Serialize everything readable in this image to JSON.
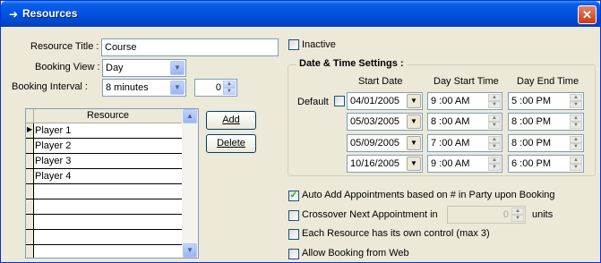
{
  "window": {
    "title": "Resources",
    "close": "✕"
  },
  "form": {
    "resource_title_label": "Resource Title :",
    "resource_title_value": "Course",
    "booking_view_label": "Booking View :",
    "booking_view_value": "Day",
    "booking_interval_label": "Booking Interval :",
    "booking_interval_value": "8 minutes",
    "interval_count": "0",
    "inactive_label": "Inactive"
  },
  "grid": {
    "header": "Resource",
    "rows": [
      "Player 1",
      "Player 2",
      "Player 3",
      "Player 4",
      "",
      "",
      "",
      "",
      ""
    ]
  },
  "buttons": {
    "add": "Add",
    "delete": "Delete"
  },
  "datetime": {
    "title": "Date & Time Settings :",
    "col_start_date": "Start Date",
    "col_day_start": "Day Start Time",
    "col_day_end": "Day End Time",
    "default_label": "Default",
    "rows": [
      {
        "date": "04/01/2005",
        "start": "9 :00 AM",
        "end": "5 :00 PM"
      },
      {
        "date": "05/03/2005",
        "start": "8 :00 AM",
        "end": "8 :00 PM"
      },
      {
        "date": "05/09/2005",
        "start": "7 :00 AM",
        "end": "8 :00 PM"
      },
      {
        "date": "10/16/2005",
        "start": "9 :00 AM",
        "end": "6 :00 PM"
      }
    ]
  },
  "options": {
    "auto_add": "Auto Add Appointments based on # in Party upon Booking",
    "auto_add_checked": true,
    "crossover": "Crossover Next Appointment in",
    "crossover_value": "0",
    "units": "units",
    "each_resource": "Each Resource has its own control (max 3)",
    "allow_web": "Allow Booking from Web"
  },
  "colors": {
    "titlebar": "#0054e3",
    "window_bg": "#ece9d8",
    "check": "#21a121"
  }
}
